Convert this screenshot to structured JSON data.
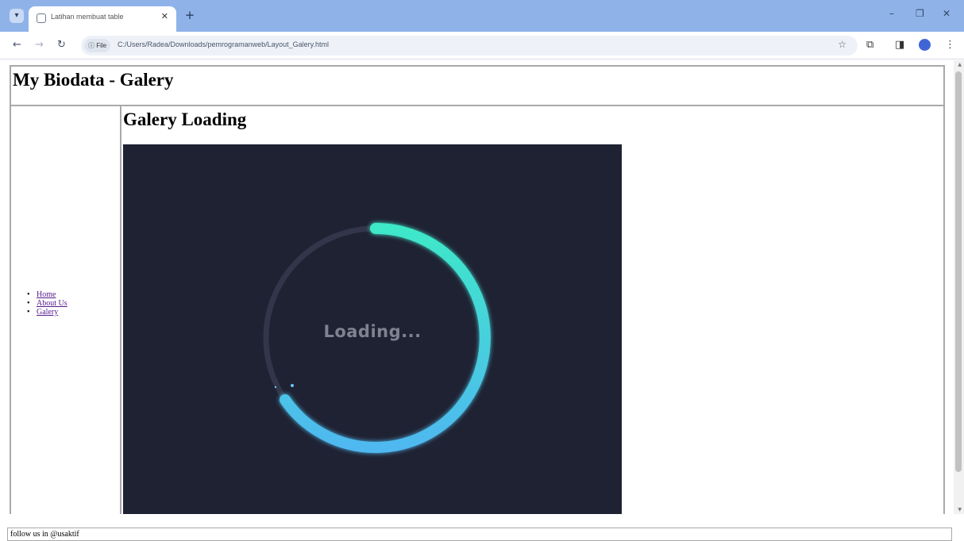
{
  "browser": {
    "tab_title": "Latihan membuat table",
    "new_tab_symbol": "+",
    "chip_label": "File",
    "url": "C:/Users/Radea/Downloads/pemrogramanweb/Layout_Galery.html",
    "window_controls": {
      "minimize": "–",
      "restore": "❐",
      "close": "✕"
    }
  },
  "page": {
    "header_title": "My Biodata - Galery",
    "main_title": "Galery Loading",
    "nav": [
      {
        "label": "Home"
      },
      {
        "label": "About Us"
      },
      {
        "label": "Galery"
      }
    ],
    "loader": {
      "text": "Loading...",
      "background": "#1f2233",
      "track_color": "#33364a",
      "gradient_start": "#3ee8c8",
      "gradient_end": "#4fb8f0"
    },
    "footer": "follow us in @usaktif"
  }
}
